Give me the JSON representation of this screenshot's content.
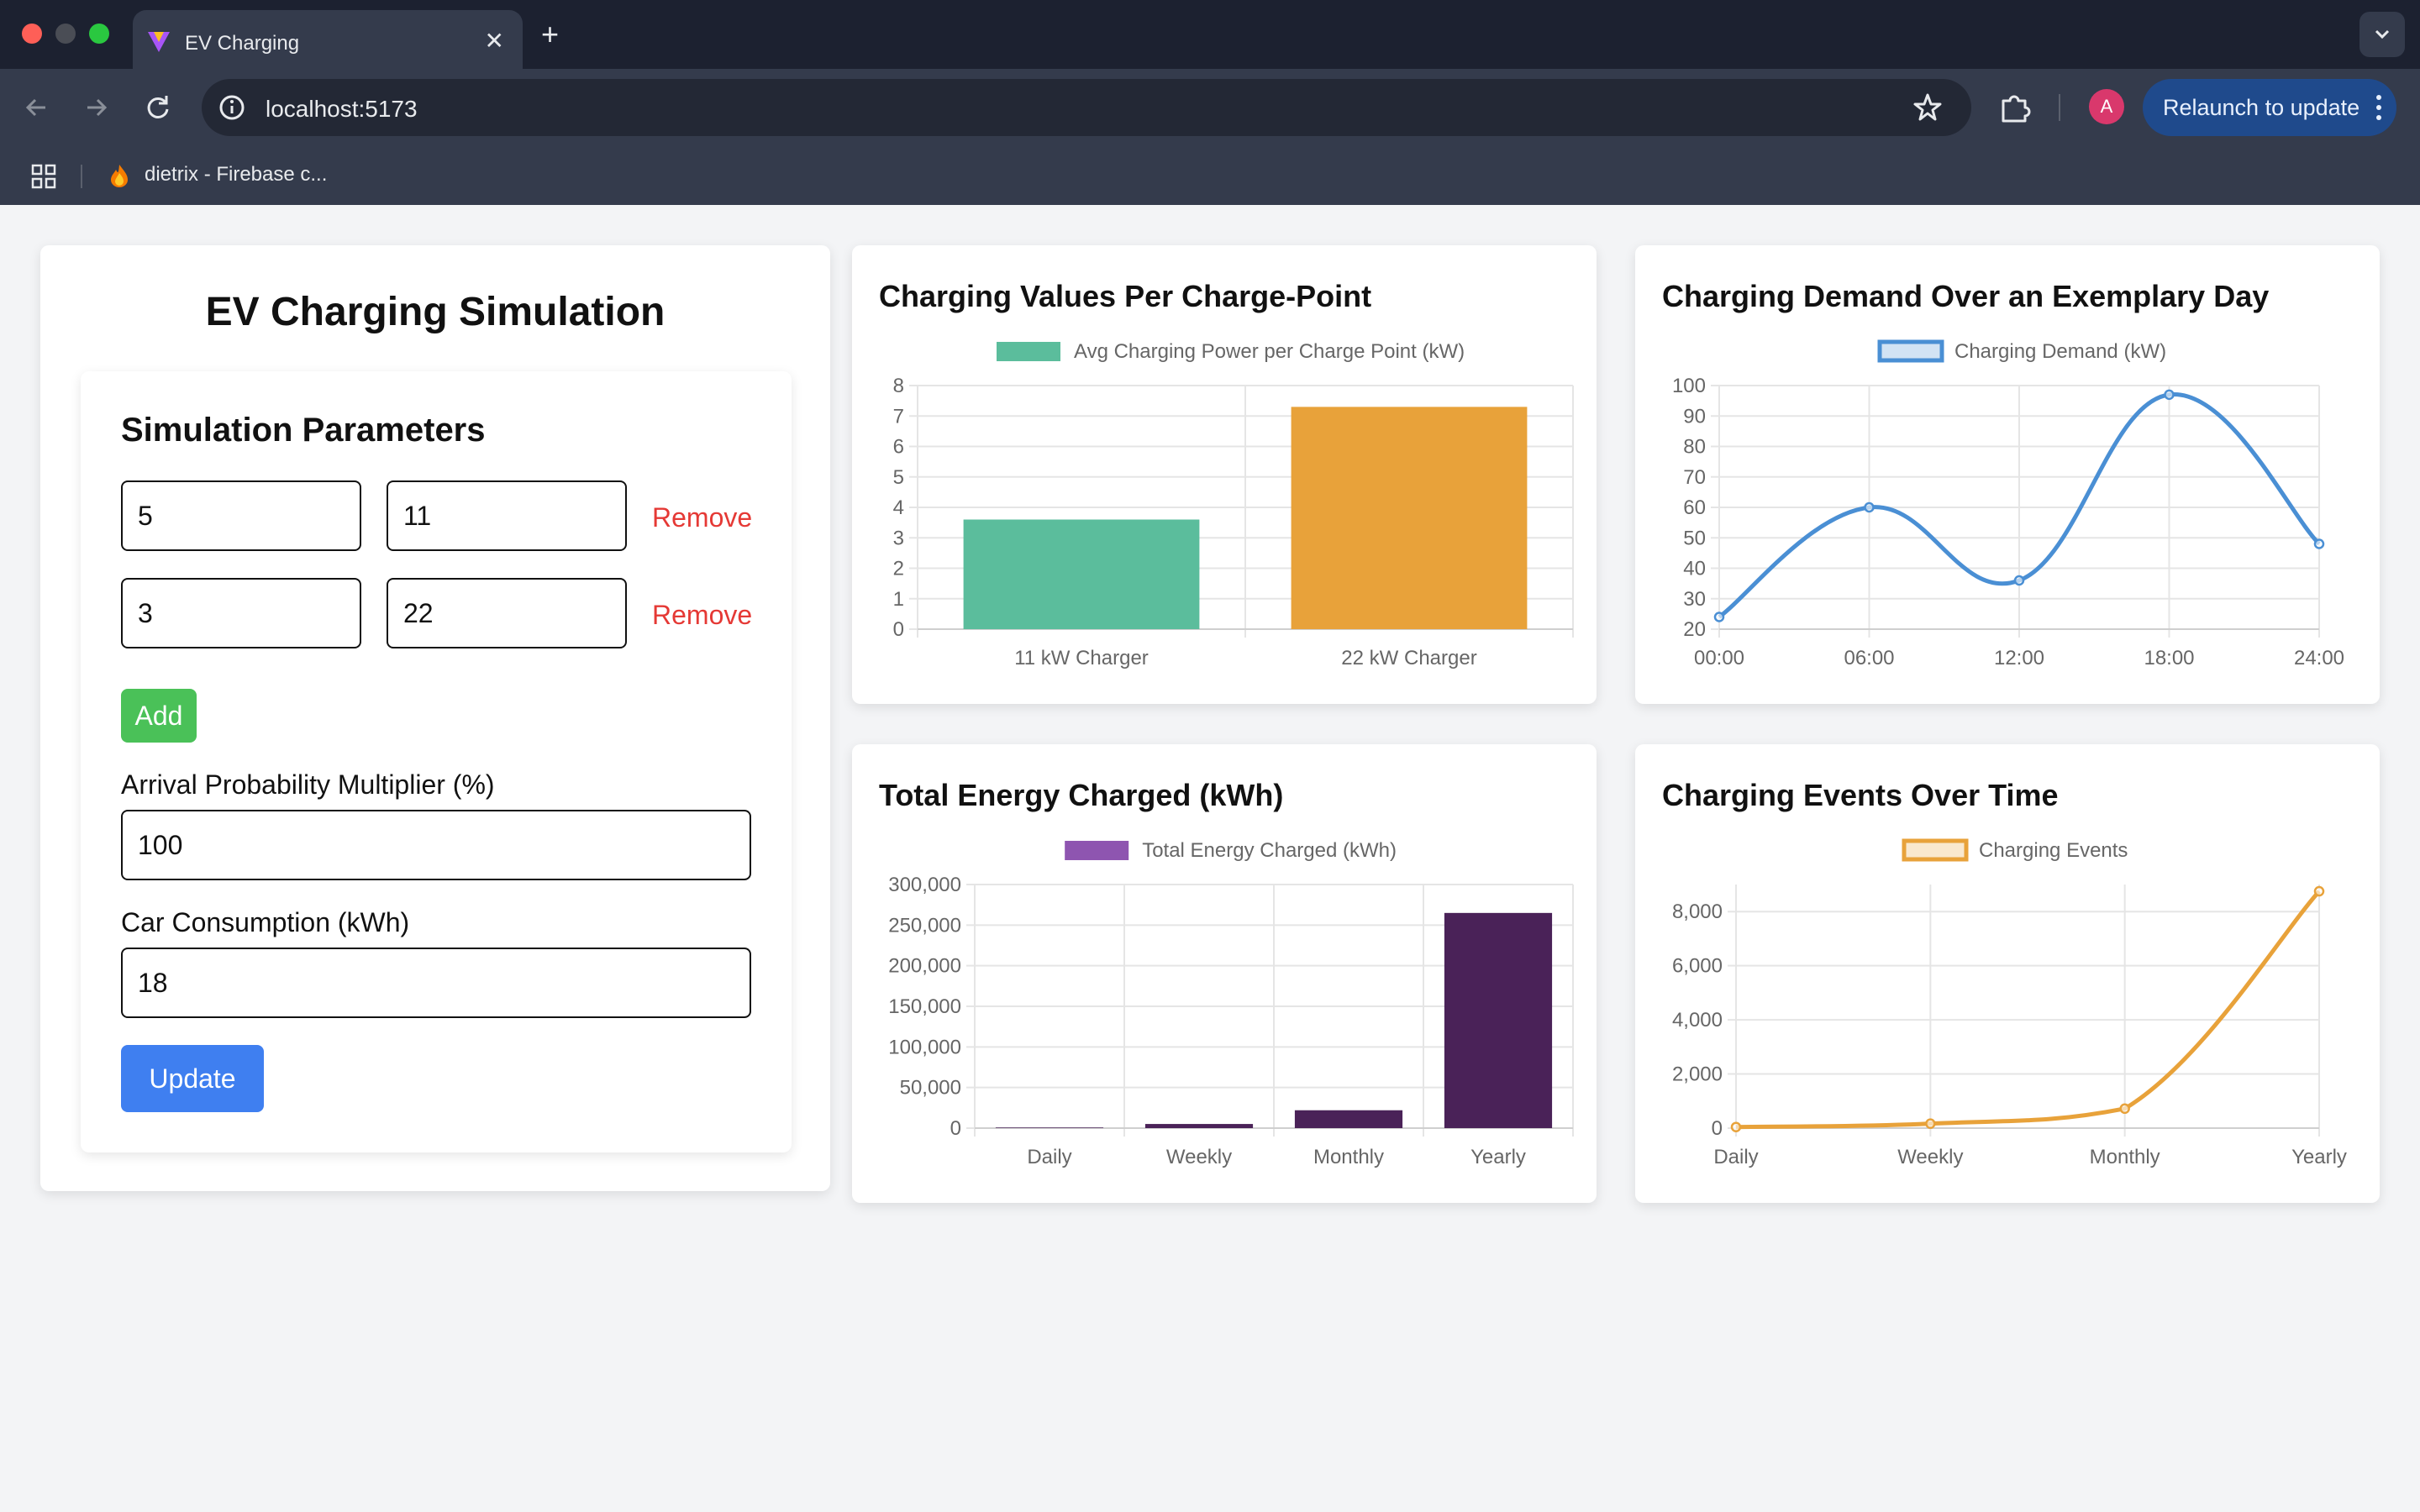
{
  "browser": {
    "tab_title": "EV Charging",
    "url": "localhost:5173",
    "relaunch_label": "Relaunch to update",
    "avatar_letter": "A",
    "bookmark_label": "dietrix - Firebase c..."
  },
  "simulation": {
    "title": "EV Charging Simulation",
    "params_title": "Simulation Parameters",
    "charger_rows": [
      {
        "count": "5",
        "power": "11",
        "remove_label": "Remove"
      },
      {
        "count": "3",
        "power": "22",
        "remove_label": "Remove"
      }
    ],
    "add_label": "Add",
    "arrival_label": "Arrival Probability Multiplier (%)",
    "arrival_value": "100",
    "consumption_label": "Car Consumption (kWh)",
    "consumption_value": "18",
    "update_label": "Update"
  },
  "charts": {
    "power_title": "Charging Values Per Charge-Point",
    "demand_title": "Charging Demand Over an Exemplary Day",
    "energy_title": "Total Energy Charged (kWh)",
    "events_title": "Charging Events Over Time"
  },
  "chart_data": [
    {
      "id": "power",
      "type": "bar",
      "categories": [
        "11 kW Charger",
        "22 kW Charger"
      ],
      "series": [
        {
          "name": "Avg Charging Power per Charge Point (kW)",
          "values": [
            3.6,
            7.3
          ],
          "colors": [
            "#5bbd9c",
            "#e8a23a"
          ]
        }
      ],
      "ylim": [
        0,
        8
      ],
      "yticks": [
        "0",
        "1",
        "2",
        "3",
        "4",
        "5",
        "6",
        "7",
        "8"
      ],
      "legend": "top",
      "grid": true
    },
    {
      "id": "demand",
      "type": "line",
      "x": [
        "00:00",
        "06:00",
        "12:00",
        "18:00",
        "24:00"
      ],
      "series": [
        {
          "name": "Charging Demand (kW)",
          "values": [
            24,
            60,
            36,
            97,
            48
          ],
          "color": "#4a8fd4"
        }
      ],
      "ylim": [
        20,
        100
      ],
      "yticks": [
        "20",
        "30",
        "40",
        "50",
        "60",
        "70",
        "80",
        "90",
        "100"
      ],
      "legend": "top",
      "grid": true
    },
    {
      "id": "energy",
      "type": "bar",
      "categories": [
        "Daily",
        "Weekly",
        "Monthly",
        "Yearly"
      ],
      "series": [
        {
          "name": "Total Energy Charged (kWh)",
          "values": [
            730,
            5100,
            22000,
            265000
          ],
          "color": "#4a2258",
          "legend_color": "#8e55b0"
        }
      ],
      "ylim": [
        0,
        300000
      ],
      "yticks": [
        "0",
        "50,000",
        "100,000",
        "150,000",
        "200,000",
        "250,000",
        "300,000"
      ],
      "legend": "top",
      "grid": true
    },
    {
      "id": "events",
      "type": "line",
      "x": [
        "Daily",
        "Weekly",
        "Monthly",
        "Yearly"
      ],
      "series": [
        {
          "name": "Charging Events",
          "values": [
            40,
            165,
            720,
            8750
          ],
          "color": "#e8a23a"
        }
      ],
      "ylim": [
        0,
        9000
      ],
      "yticks": [
        "0",
        "2,000",
        "4,000",
        "6,000",
        "8,000"
      ],
      "ytick_values": [
        0,
        2000,
        4000,
        6000,
        8000
      ],
      "legend": "top",
      "grid": true
    }
  ]
}
